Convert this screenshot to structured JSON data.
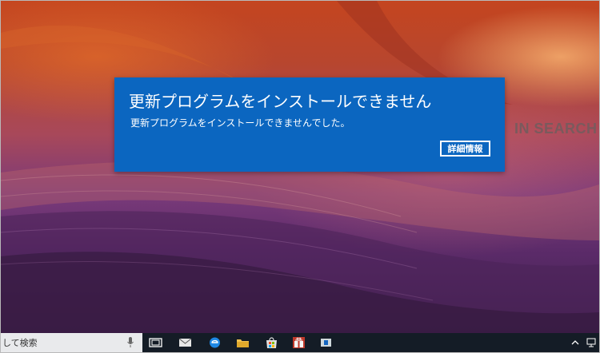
{
  "wallpaper": {
    "side_text": "IN SEARCH OI"
  },
  "dialog": {
    "title": "更新プログラムをインストールできません",
    "message": "更新プログラムをインストールできませんでした。",
    "details_label": "詳細情報",
    "background_color": "#0b66c0"
  },
  "taskbar": {
    "search_text": "して検索",
    "icons": [
      "task-view-icon",
      "mail-icon",
      "edge-icon",
      "file-explorer-icon",
      "store-icon",
      "gift-app-icon",
      "app-icon"
    ],
    "tray_icons": [
      "chevron-up-icon",
      "network-icon"
    ]
  }
}
